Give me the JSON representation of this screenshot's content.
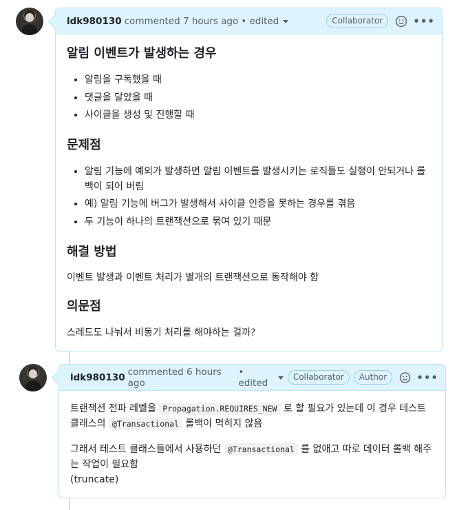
{
  "comments": [
    {
      "author": "ldk980130",
      "meta": "commented 7 hours ago",
      "edited": "• edited",
      "badges": [
        "Collaborator"
      ],
      "sections": [
        {
          "heading": "알림 이벤트가 발생하는 경우",
          "items": [
            "알림을 구독했을 때",
            "댓글을 달았을 때",
            "사이클을 생성 및 진행할 때"
          ]
        },
        {
          "heading": "문제점",
          "items": [
            "알림 기능에 예외가 발생하면 알림 이벤트를 발생시키는 로직들도 실행이 안되거나 롤백이 되어 버림",
            "예) 알림 기능에 버그가 발생해서 사이클 인증을 못하는 경우를 겪음",
            "두 기능이 하나의 트랜잭션으로 묶여 있기 때문"
          ]
        },
        {
          "heading": "해결 방법",
          "text": "이벤트 발생과 이벤트 처리가 별개의 트랜잭션으로 동작해야 함"
        },
        {
          "heading": "의문점",
          "text": "스레드도 나눠서 비동기 처리를 해야하는 걸까?"
        }
      ]
    },
    {
      "author": "ldk980130",
      "meta": "commented 6 hours ago",
      "edited": "• edited",
      "badges": [
        "Collaborator",
        "Author"
      ],
      "p1_a": "트랜잭션 전파 레벨을",
      "p1_code1": "Propagation.REQUIRES_NEW",
      "p1_b": "로 할 필요가 있는데 이 경우 테스트 클래스의",
      "p1_code2": "@Transactional",
      "p1_c": "롤백이 먹히지 않음",
      "p2_a": "그래서 테스트 클래스들에서 사용하던",
      "p2_code": "@Transactional",
      "p2_b": "를 없애고 따로 데이터 롤백 해주는 작업이 필요함",
      "p2_c": "(truncate)"
    }
  ]
}
